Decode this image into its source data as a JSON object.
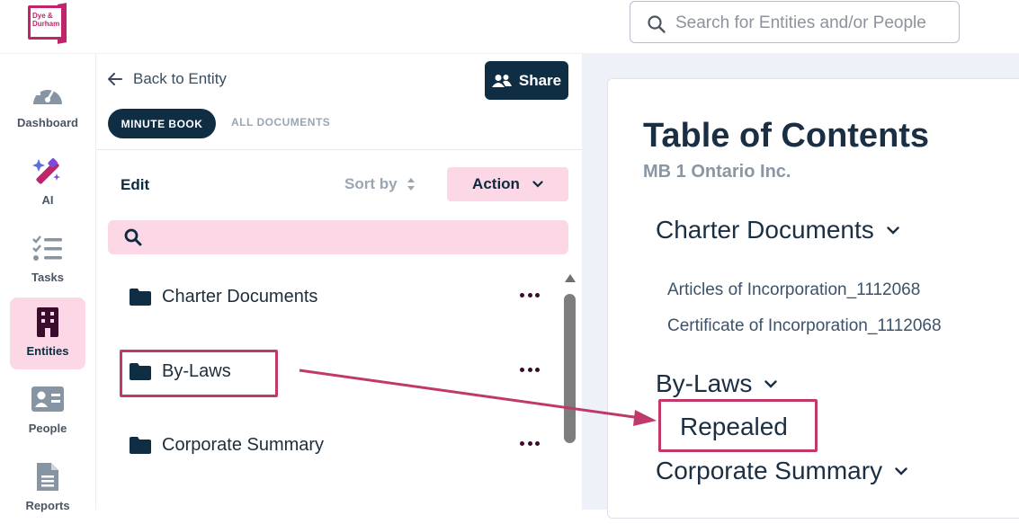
{
  "header": {
    "logo_text": [
      "Dye &",
      "Durham"
    ],
    "search_placeholder": "Search for Entities and/or People"
  },
  "sidebar": {
    "items": [
      {
        "label": "Dashboard",
        "icon": "gauge-icon",
        "active": false
      },
      {
        "label": "AI",
        "icon": "magic-wand-icon",
        "active": false
      },
      {
        "label": "Tasks",
        "icon": "checklist-icon",
        "active": false
      },
      {
        "label": "Entities",
        "icon": "building-icon",
        "active": true
      },
      {
        "label": "People",
        "icon": "id-card-icon",
        "active": false
      },
      {
        "label": "Reports",
        "icon": "document-icon",
        "active": false
      }
    ]
  },
  "panel": {
    "back_label": "Back to Entity",
    "share_label": "Share",
    "tabs": [
      {
        "label": "MINUTE BOOK",
        "active": true
      },
      {
        "label": "ALL DOCUMENTS",
        "active": false
      }
    ],
    "edit_label": "Edit",
    "sort_label": "Sort by",
    "action_label": "Action",
    "folders": [
      {
        "label": "Charter Documents"
      },
      {
        "label": "By-Laws",
        "highlighted": true
      },
      {
        "label": "Corporate Summary"
      }
    ]
  },
  "toc": {
    "title": "Table of Contents",
    "entity": "MB 1 Ontario Inc.",
    "sections": [
      {
        "label": "Charter Documents",
        "documents": [
          "Articles of Incorporation_1112068",
          "Certificate of Incorporation_1112068"
        ]
      },
      {
        "label": "By-Laws",
        "documents": [
          "Repealed"
        ]
      },
      {
        "label": "Corporate Summary",
        "documents": []
      }
    ]
  },
  "colors": {
    "brand": "#c0256b",
    "navy": "#0f2e44",
    "pink_fill": "#fcd7e6",
    "annotation": "#c0396b"
  }
}
